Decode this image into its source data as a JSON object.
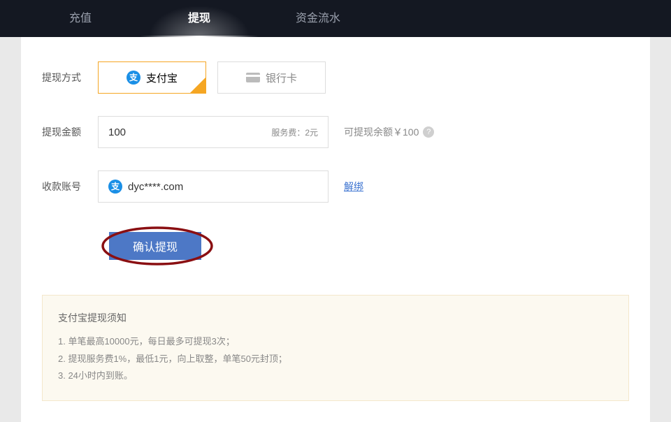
{
  "tabs": {
    "recharge": "充值",
    "withdraw": "提现",
    "flow": "资金流水"
  },
  "labels": {
    "method": "提现方式",
    "amount": "提现金额",
    "account": "收款账号"
  },
  "methods": {
    "alipay": "支付宝",
    "bank": "银行卡"
  },
  "amount": {
    "value": "100",
    "fee": "服务费：2元"
  },
  "balance": {
    "text": "可提现余额￥100"
  },
  "account": {
    "display": "dyc****.com",
    "unbind": "解绑"
  },
  "submit": {
    "label": "确认提现"
  },
  "notice": {
    "title": "支付宝提现须知",
    "l1": "1. 单笔最高10000元，每日最多可提现3次；",
    "l2": "2. 提现服务费1%，最低1元，向上取整，单笔50元封顶；",
    "l3": "3. 24小时内到账。"
  }
}
